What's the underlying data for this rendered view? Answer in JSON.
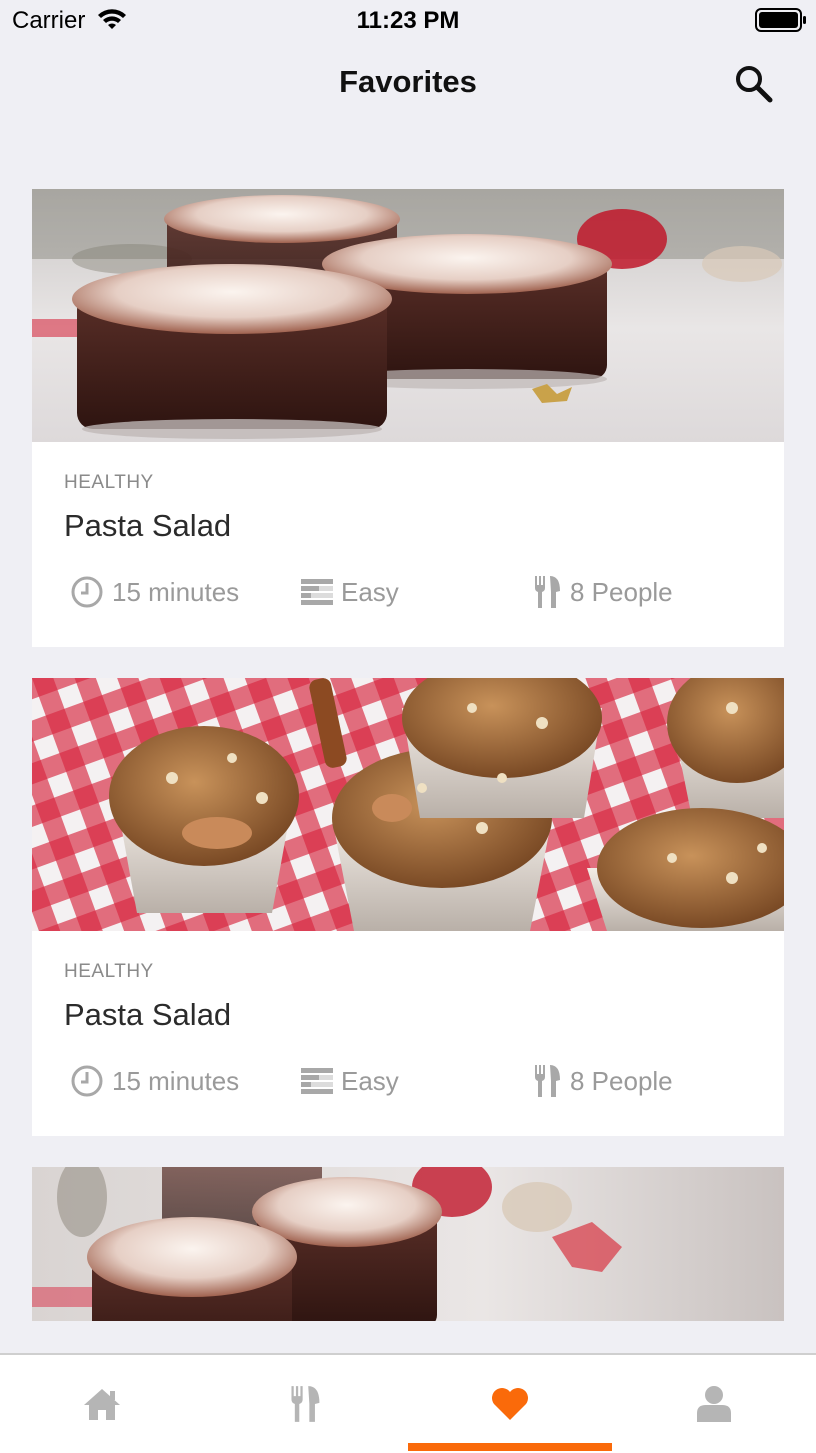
{
  "status_bar": {
    "carrier": "Carrier",
    "time": "11:23 PM"
  },
  "nav": {
    "title": "Favorites",
    "search_icon": "search-icon"
  },
  "recipes": [
    {
      "category": "HEALTHY",
      "title": "Pasta Salad",
      "time": "15 minutes",
      "difficulty": "Easy",
      "servings": "8 People",
      "image": "hot-chocolate-photo"
    },
    {
      "category": "HEALTHY",
      "title": "Pasta Salad",
      "time": "15 minutes",
      "difficulty": "Easy",
      "servings": "8 People",
      "image": "muffins-photo"
    },
    {
      "image": "hot-chocolate-photo"
    }
  ],
  "tabs": [
    {
      "name": "home",
      "icon": "home-icon",
      "active": false
    },
    {
      "name": "recipes",
      "icon": "fork-knife-icon",
      "active": false
    },
    {
      "name": "favorites",
      "icon": "heart-icon",
      "active": true
    },
    {
      "name": "profile",
      "icon": "user-icon",
      "active": false
    }
  ],
  "colors": {
    "accent": "#fa6a0a",
    "inactive_icon": "#b5b5b5",
    "meta_text": "#9a9a9a",
    "background": "#efeff4"
  }
}
